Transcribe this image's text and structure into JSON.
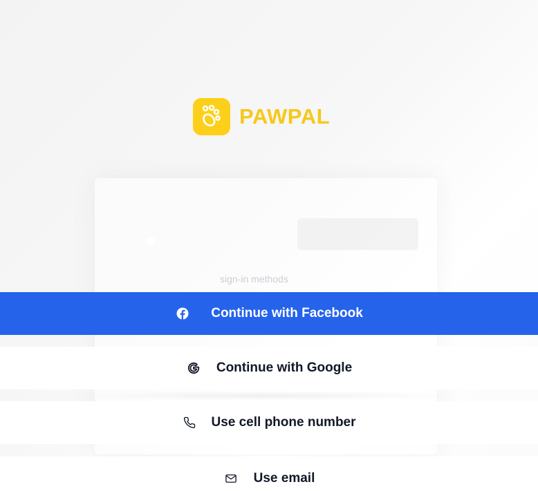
{
  "brand": {
    "name": "PAWPAL",
    "color": "#fcd01a",
    "icon": "paw-icon"
  },
  "background": {
    "methods_text": "sign-in methods"
  },
  "auth_options": [
    {
      "id": "facebook",
      "label": "Continue with Facebook",
      "icon": "facebook-icon",
      "bg": "#2563eb"
    },
    {
      "id": "google",
      "label": "Continue with Google",
      "icon": "google-icon",
      "bg": "#ffffff"
    },
    {
      "id": "phone",
      "label": "Use cell phone number",
      "icon": "phone-icon",
      "bg": "#ffffff"
    },
    {
      "id": "email",
      "label": "Use email",
      "icon": "mail-icon",
      "bg": "#ffffff"
    }
  ]
}
